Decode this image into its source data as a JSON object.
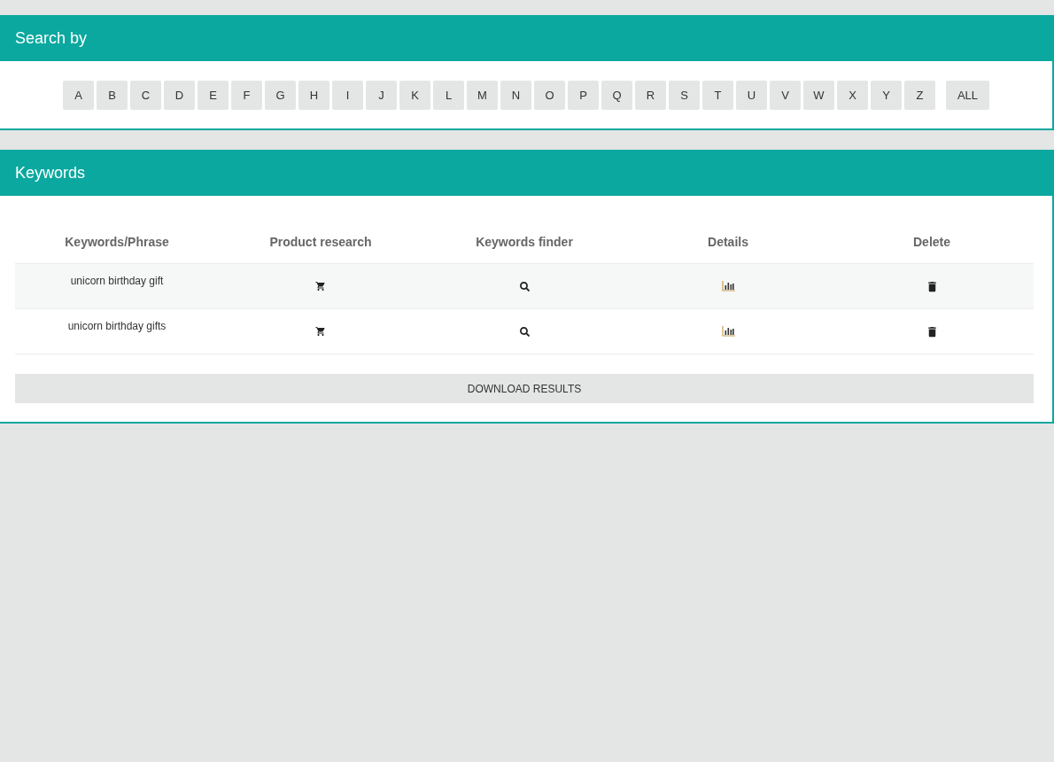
{
  "search_panel": {
    "title": "Search by",
    "letters": [
      "A",
      "B",
      "C",
      "D",
      "E",
      "F",
      "G",
      "H",
      "I",
      "J",
      "K",
      "L",
      "M",
      "N",
      "O",
      "P",
      "Q",
      "R",
      "S",
      "T",
      "U",
      "V",
      "W",
      "X",
      "Y",
      "Z"
    ],
    "all_button": "ALL"
  },
  "keywords_panel": {
    "title": "Keywords",
    "table": {
      "columns": [
        "Keywords/Phrase",
        "Product research",
        "Keywords finder",
        "Details",
        "Delete"
      ],
      "rows": [
        {
          "keyword": "unicorn birthday gift"
        },
        {
          "keyword": "unicorn birthday gifts"
        }
      ]
    },
    "download_button": "DOWNLOAD RESULTS"
  }
}
